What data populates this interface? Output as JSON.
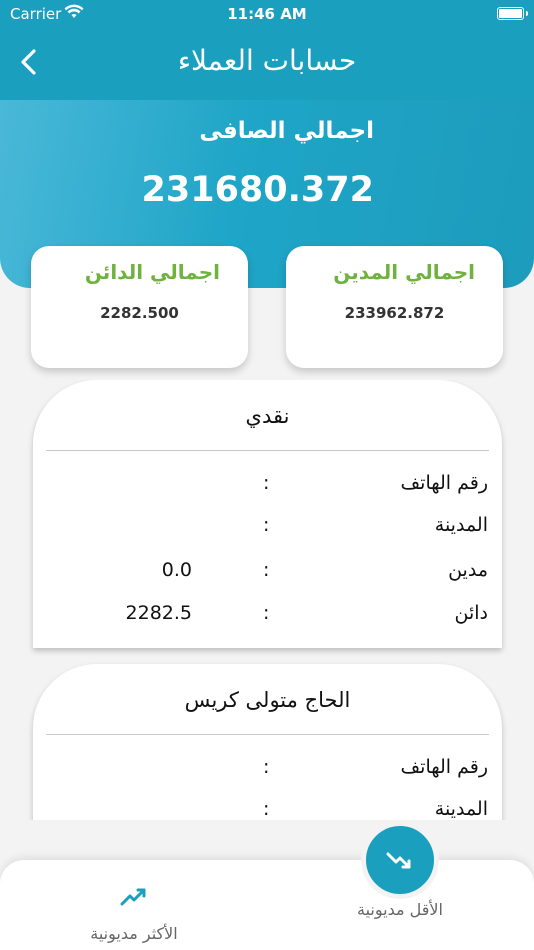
{
  "status_bar": {
    "carrier": "Carrier",
    "time": "11:46 AM"
  },
  "header": {
    "title": "حسابات العملاء",
    "back_icon": "chevron-left-icon"
  },
  "summary": {
    "net_label": "اجمالي الصافى",
    "net_value": "231680.372",
    "debit_label": "اجمالي المدين",
    "debit_value": "233962.872",
    "credit_label": "اجمالي الدائن",
    "credit_value": "2282.500"
  },
  "field_labels": {
    "phone": "رقم الهاتف",
    "city": "المدينة",
    "debit": "مدين",
    "credit": "دائن",
    "separator": ":"
  },
  "customers": [
    {
      "name": "نقدي",
      "phone": "",
      "city": "",
      "debit": "0.0",
      "credit": "2282.5"
    },
    {
      "name": "الحاج متولى كريس",
      "phone": "",
      "city": ""
    }
  ],
  "bottom_nav": {
    "less_debt_label": "الأقل مديونية",
    "less_debt_icon": "trending-down-icon",
    "most_debt_label": "الأكثر مديونية",
    "most_debt_icon": "trending-up-icon"
  },
  "colors": {
    "primary": "#1a9fbf",
    "accent_green": "#6fb23d",
    "background": "#f3f3f3"
  }
}
